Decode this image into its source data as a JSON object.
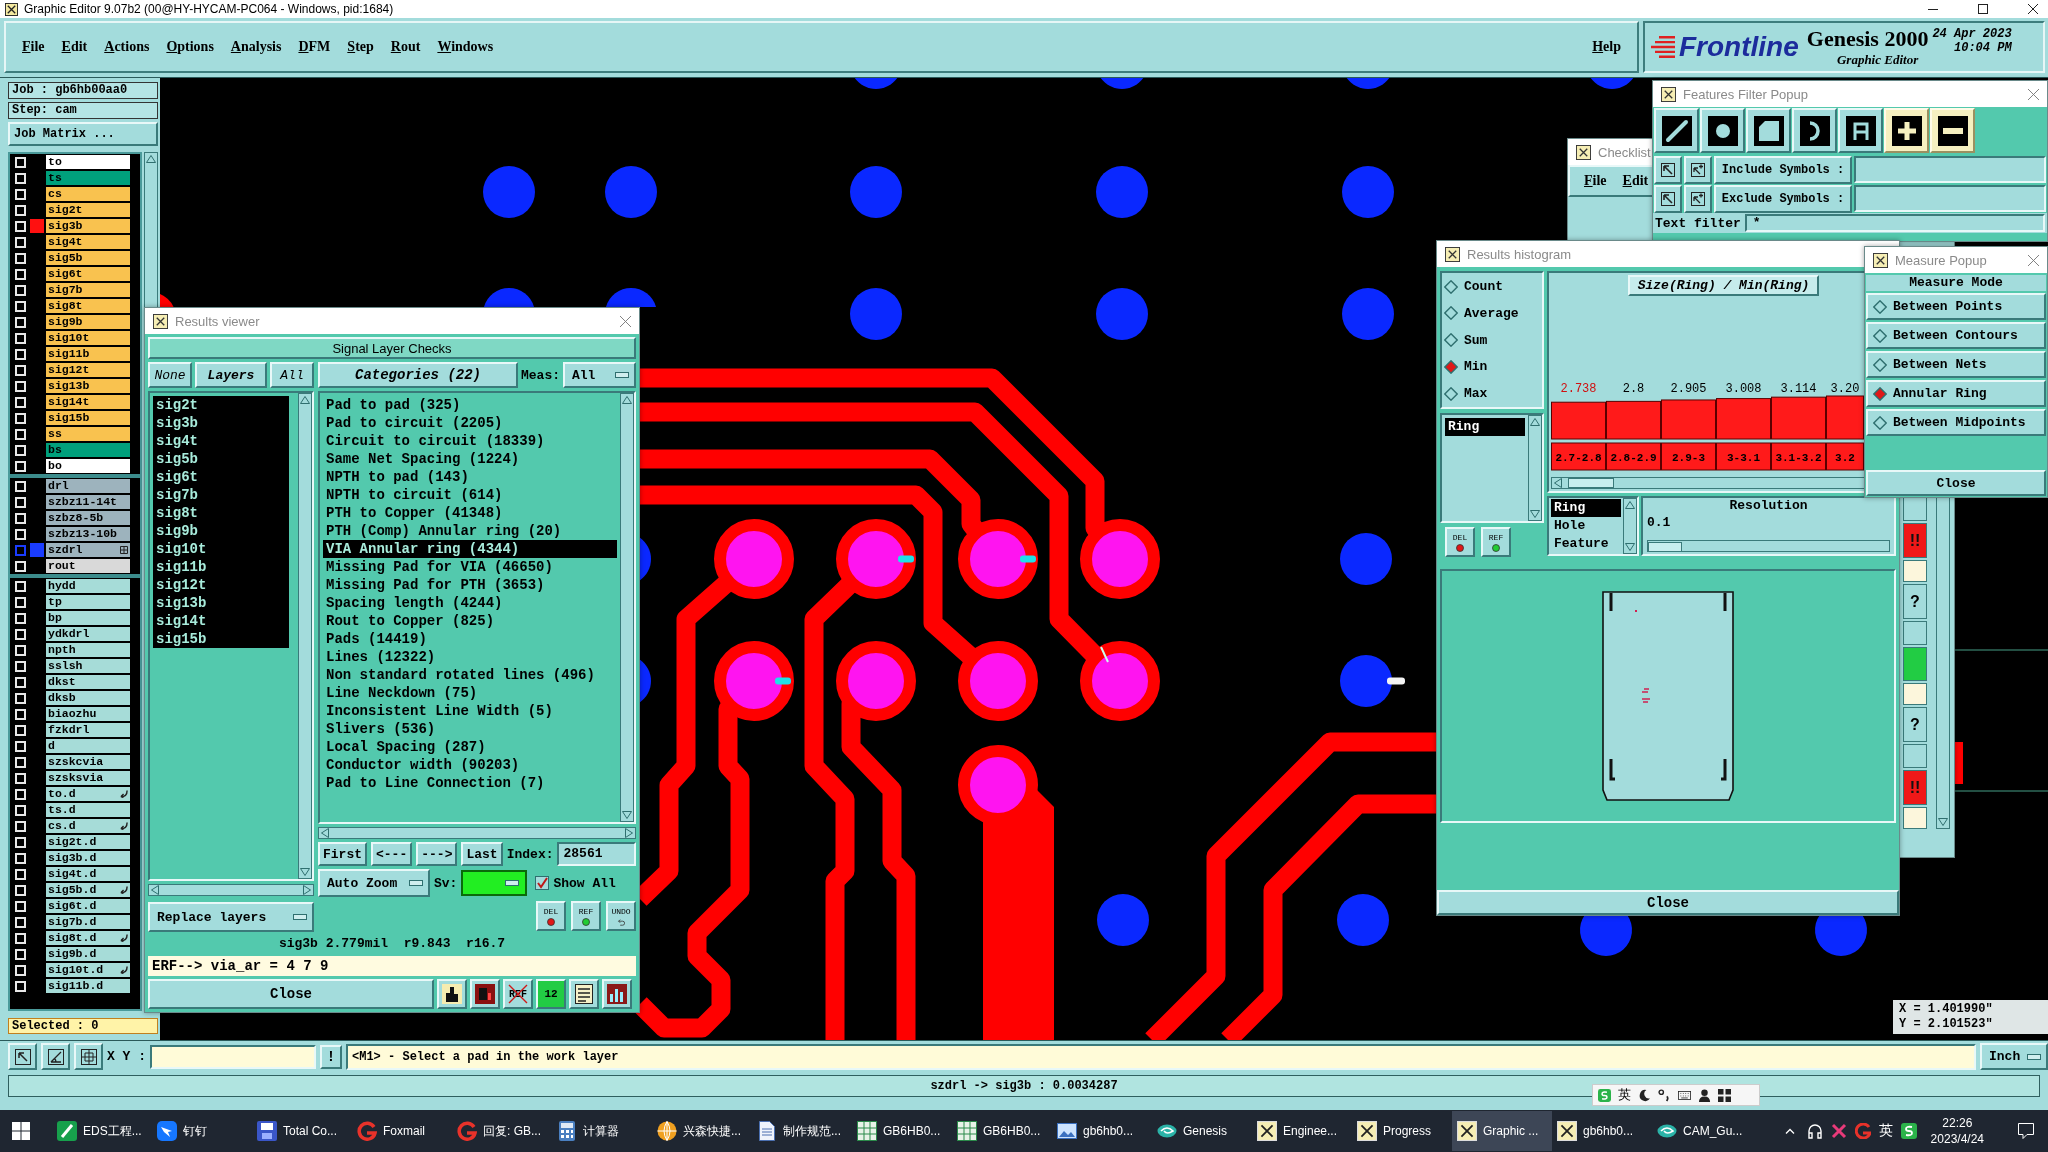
{
  "window": {
    "title": "Graphic Editor 9.07b2 (00@HY-HYCAM-PC064 - Windows, pid:1684)"
  },
  "menu": {
    "items": [
      "File",
      "Edit",
      "Actions",
      "Options",
      "Analysis",
      "DFM",
      "Step",
      "Rout",
      "Windows"
    ],
    "help": "Help"
  },
  "logo": {
    "brand": "Frontline",
    "product": "Genesis 2000",
    "subtitle": "Graphic Editor",
    "date": "24 Apr 2023",
    "time": "10:04 PM"
  },
  "job_panel": {
    "job": "Job : gb6hb00aa0",
    "step": "Step: cam",
    "matrix_button": "Job Matrix ...",
    "layer_groups": [
      {
        "layers": [
          {
            "name": "to",
            "color": "#ffffff",
            "checked": false,
            "work": false,
            "displayed": false,
            "kind": "plain"
          },
          {
            "name": "ts",
            "color": "#00a07c",
            "checked": false,
            "work": false,
            "displayed": false,
            "kind": "plain"
          },
          {
            "name": "cs",
            "color": "#f9c24f",
            "checked": false,
            "work": false,
            "displayed": false,
            "kind": "plain"
          },
          {
            "name": "sig2t",
            "color": "#f9c24f",
            "checked": false,
            "work": false,
            "displayed": false,
            "kind": "plain"
          },
          {
            "name": "sig3b",
            "color": "#f9c24f",
            "checked": false,
            "work": true,
            "displayed": false,
            "kind": "plain"
          },
          {
            "name": "sig4t",
            "color": "#f9c24f",
            "checked": false,
            "work": false,
            "displayed": false,
            "kind": "plain"
          },
          {
            "name": "sig5b",
            "color": "#f9c24f",
            "checked": false,
            "work": false,
            "displayed": false,
            "kind": "plain"
          },
          {
            "name": "sig6t",
            "color": "#f9c24f",
            "checked": false,
            "work": false,
            "displayed": false,
            "kind": "plain"
          },
          {
            "name": "sig7b",
            "color": "#f9c24f",
            "checked": false,
            "work": false,
            "displayed": false,
            "kind": "plain"
          },
          {
            "name": "sig8t",
            "color": "#f9c24f",
            "checked": false,
            "work": false,
            "displayed": false,
            "kind": "plain"
          },
          {
            "name": "sig9b",
            "color": "#f9c24f",
            "checked": false,
            "work": false,
            "displayed": false,
            "kind": "plain"
          },
          {
            "name": "sig10t",
            "color": "#f9c24f",
            "checked": false,
            "work": false,
            "displayed": false,
            "kind": "plain"
          },
          {
            "name": "sig11b",
            "color": "#f9c24f",
            "checked": false,
            "work": false,
            "displayed": false,
            "kind": "plain"
          },
          {
            "name": "sig12t",
            "color": "#f9c24f",
            "checked": false,
            "work": false,
            "displayed": false,
            "kind": "plain"
          },
          {
            "name": "sig13b",
            "color": "#f9c24f",
            "checked": false,
            "work": false,
            "displayed": false,
            "kind": "plain"
          },
          {
            "name": "sig14t",
            "color": "#f9c24f",
            "checked": false,
            "work": false,
            "displayed": false,
            "kind": "plain"
          },
          {
            "name": "sig15b",
            "color": "#f9c24f",
            "checked": false,
            "work": false,
            "displayed": false,
            "kind": "plain"
          },
          {
            "name": "ss",
            "color": "#f9c24f",
            "checked": false,
            "work": false,
            "displayed": false,
            "kind": "plain"
          },
          {
            "name": "bs",
            "color": "#00a07c",
            "checked": false,
            "work": false,
            "displayed": false,
            "kind": "plain"
          },
          {
            "name": "bo",
            "color": "#ffffff",
            "checked": false,
            "work": false,
            "displayed": false,
            "kind": "plain"
          }
        ]
      },
      {
        "layers": [
          {
            "name": "drl",
            "color": "#9db3bd",
            "checked": false,
            "work": false,
            "displayed": false,
            "kind": "plain"
          },
          {
            "name": "szbz11-14t",
            "color": "#9db3bd",
            "checked": false,
            "work": false,
            "displayed": false,
            "kind": "plain"
          },
          {
            "name": "szbz8-5b",
            "color": "#9db3bd",
            "checked": false,
            "work": false,
            "displayed": false,
            "kind": "plain"
          },
          {
            "name": "szbz13-10b",
            "color": "#9db3bd",
            "checked": false,
            "work": false,
            "displayed": false,
            "kind": "plain"
          },
          {
            "name": "szdrl",
            "color": "#9db3bd",
            "checked": false,
            "work": false,
            "displayed": true,
            "kind": "grid"
          },
          {
            "name": "rout",
            "color": "#d9d9d9",
            "checked": false,
            "work": false,
            "displayed": false,
            "kind": "plain"
          }
        ]
      },
      {
        "layers": [
          {
            "name": "hydd",
            "color": "#a6dcd8",
            "checked": false,
            "work": false,
            "displayed": false,
            "kind": "plain"
          },
          {
            "name": "tp",
            "color": "#a6dcd8",
            "checked": false,
            "work": false,
            "displayed": false,
            "kind": "plain"
          },
          {
            "name": "bp",
            "color": "#a6dcd8",
            "checked": false,
            "work": false,
            "displayed": false,
            "kind": "plain"
          },
          {
            "name": "ydkdrl",
            "color": "#a6dcd8",
            "checked": false,
            "work": false,
            "displayed": false,
            "kind": "plain"
          },
          {
            "name": "npth",
            "color": "#a6dcd8",
            "checked": false,
            "work": false,
            "displayed": false,
            "kind": "plain"
          },
          {
            "name": "sslsh",
            "color": "#a6dcd8",
            "checked": false,
            "work": false,
            "displayed": false,
            "kind": "plain"
          },
          {
            "name": "dkst",
            "color": "#a6dcd8",
            "checked": false,
            "work": false,
            "displayed": false,
            "kind": "plain"
          },
          {
            "name": "dksb",
            "color": "#a6dcd8",
            "checked": false,
            "work": false,
            "displayed": false,
            "kind": "plain"
          },
          {
            "name": "biaozhu",
            "color": "#a6dcd8",
            "checked": false,
            "work": false,
            "displayed": false,
            "kind": "plain"
          },
          {
            "name": "fzkdrl",
            "color": "#a6dcd8",
            "checked": false,
            "work": false,
            "displayed": false,
            "kind": "plain"
          },
          {
            "name": "d",
            "color": "#a6dcd8",
            "checked": false,
            "work": false,
            "displayed": false,
            "kind": "plain"
          },
          {
            "name": "szskcvia",
            "color": "#a6dcd8",
            "checked": false,
            "work": false,
            "displayed": false,
            "kind": "plain"
          },
          {
            "name": "szsksvia",
            "color": "#a6dcd8",
            "checked": false,
            "work": false,
            "displayed": false,
            "kind": "plain"
          },
          {
            "name": "to.d",
            "color": "#a6dcd8",
            "checked": false,
            "work": false,
            "displayed": false,
            "kind": "hook"
          },
          {
            "name": "ts.d",
            "color": "#a6dcd8",
            "checked": false,
            "work": false,
            "displayed": false,
            "kind": "plain"
          },
          {
            "name": "cs.d",
            "color": "#a6dcd8",
            "checked": false,
            "work": false,
            "displayed": false,
            "kind": "hook"
          },
          {
            "name": "sig2t.d",
            "color": "#a6dcd8",
            "checked": false,
            "work": false,
            "displayed": false,
            "kind": "plain"
          },
          {
            "name": "sig3b.d",
            "color": "#a6dcd8",
            "checked": false,
            "work": false,
            "displayed": false,
            "kind": "plain"
          },
          {
            "name": "sig4t.d",
            "color": "#a6dcd8",
            "checked": false,
            "work": false,
            "displayed": false,
            "kind": "plain"
          },
          {
            "name": "sig5b.d",
            "color": "#a6dcd8",
            "checked": false,
            "work": false,
            "displayed": false,
            "kind": "hook"
          },
          {
            "name": "sig6t.d",
            "color": "#a6dcd8",
            "checked": false,
            "work": false,
            "displayed": false,
            "kind": "plain"
          },
          {
            "name": "sig7b.d",
            "color": "#a6dcd8",
            "checked": false,
            "work": false,
            "displayed": false,
            "kind": "plain"
          },
          {
            "name": "sig8t.d",
            "color": "#a6dcd8",
            "checked": false,
            "work": false,
            "displayed": false,
            "kind": "hook"
          },
          {
            "name": "sig9b.d",
            "color": "#a6dcd8",
            "checked": false,
            "work": false,
            "displayed": false,
            "kind": "plain"
          },
          {
            "name": "sig10t.d",
            "color": "#a6dcd8",
            "checked": false,
            "work": false,
            "displayed": false,
            "kind": "hook"
          },
          {
            "name": "sig11b.d",
            "color": "#a6dcd8",
            "checked": false,
            "work": false,
            "displayed": false,
            "kind": "plain"
          }
        ]
      }
    ],
    "selected_count": "Selected : 0"
  },
  "canvas": {
    "readout_x": "X = 1.401990\"",
    "readout_y": "Y = 2.101523\""
  },
  "results_viewer": {
    "title": "Results viewer",
    "header": "Signal Layer Checks",
    "layer_buttons": [
      {
        "label": "None",
        "kind": "toggle"
      },
      {
        "label": "Layers",
        "kind": "title"
      },
      {
        "label": "All",
        "kind": "toggle"
      }
    ],
    "layers": [
      {
        "name": "sig2t",
        "selected": true
      },
      {
        "name": "sig3b",
        "selected": true
      },
      {
        "name": "sig4t",
        "selected": true
      },
      {
        "name": "sig5b",
        "selected": true
      },
      {
        "name": "sig6t",
        "selected": true
      },
      {
        "name": "sig7b",
        "selected": true
      },
      {
        "name": "sig8t",
        "selected": true
      },
      {
        "name": "sig9b",
        "selected": true
      },
      {
        "name": "sig10t",
        "selected": true
      },
      {
        "name": "sig11b",
        "selected": true
      },
      {
        "name": "sig12t",
        "selected": true
      },
      {
        "name": "sig13b",
        "selected": true
      },
      {
        "name": "sig14t",
        "selected": true
      },
      {
        "name": "sig15b",
        "selected": true
      }
    ],
    "replace": "Replace layers",
    "categories_button": "Categories (22)",
    "meas_label": "Meas:",
    "meas_value": "All",
    "categories": [
      {
        "label": "Pad to pad (325)",
        "selected": false
      },
      {
        "label": "Pad to circuit (2205)",
        "selected": false
      },
      {
        "label": "Circuit to circuit (18339)",
        "selected": false
      },
      {
        "label": "Same Net Spacing (1224)",
        "selected": false
      },
      {
        "label": "NPTH to pad (143)",
        "selected": false
      },
      {
        "label": "NPTH to circuit (614)",
        "selected": false
      },
      {
        "label": "PTH to Copper (41348)",
        "selected": false
      },
      {
        "label": "PTH (Comp) Annular ring (20)",
        "selected": false
      },
      {
        "label": "VIA Annular ring (4344)",
        "selected": true
      },
      {
        "label": "Missing Pad for VIA (46650)",
        "selected": false
      },
      {
        "label": "Missing Pad for PTH (3653)",
        "selected": false
      },
      {
        "label": "Spacing length (4244)",
        "selected": false
      },
      {
        "label": "Rout to Copper (825)",
        "selected": false
      },
      {
        "label": "Pads (14419)",
        "selected": false
      },
      {
        "label": "Lines (12322)",
        "selected": false
      },
      {
        "label": "Non standard rotated lines (496)",
        "selected": false
      },
      {
        "label": "Line Neckdown (75)",
        "selected": false
      },
      {
        "label": "Inconsistent Line Width (5)",
        "selected": false
      },
      {
        "label": "Slivers (536)",
        "selected": false
      },
      {
        "label": "Local Spacing (287)",
        "selected": false
      },
      {
        "label": "Conductor width (90203)",
        "selected": false
      },
      {
        "label": "Pad to Line Connection (7)",
        "selected": false
      }
    ],
    "nav": [
      "First",
      "<---",
      "--->",
      "Last"
    ],
    "index_label": "Index:",
    "index_value": "28561",
    "zoom_mode": "Auto Zoom",
    "sv": {
      "label": "Sv:",
      "color": "#22ee22"
    },
    "show_all": {
      "label": "Show All",
      "checked": true
    },
    "tools": [
      {
        "kind": "del",
        "label": "DEL"
      },
      {
        "kind": "ref",
        "label": "REF"
      },
      {
        "kind": "undo",
        "label": "UNDO"
      }
    ],
    "info": "sig3b 2.779mil  r9.843  r16.7",
    "erf": "ERF--> via_ar = 4 7 9",
    "close": "Close",
    "bottom_tools": [
      {
        "kind": "figure"
      },
      {
        "kind": "stop"
      },
      {
        "kind": "ref-off",
        "label": "REF"
      },
      {
        "kind": "count",
        "label": "12"
      },
      {
        "kind": "report"
      },
      {
        "kind": "chart"
      }
    ]
  },
  "checklist": {
    "title": "Checklist",
    "menu": [
      "File",
      "Edit"
    ],
    "status": [
      {
        "kind": "blank"
      },
      {
        "kind": "fail",
        "mark": "!!"
      },
      {
        "kind": "pending"
      },
      {
        "kind": "query",
        "mark": "?"
      },
      {
        "kind": "blank"
      },
      {
        "kind": "pass"
      },
      {
        "kind": "pending"
      },
      {
        "kind": "query",
        "mark": "?"
      },
      {
        "kind": "blank"
      },
      {
        "kind": "fail",
        "mark": "!!"
      },
      {
        "kind": "pending"
      }
    ]
  },
  "features_filter": {
    "title": "Features Filter Popup",
    "types": [
      {
        "kind": "line"
      },
      {
        "kind": "pad"
      },
      {
        "kind": "surface"
      },
      {
        "kind": "arc"
      },
      {
        "kind": "text"
      }
    ],
    "modes": [
      {
        "kind": "plus"
      },
      {
        "kind": "minus"
      }
    ],
    "include_label": "Include Symbols :",
    "exclude_label": "Exclude Symbols :",
    "text_filter_label": "Text filter",
    "text_filter_value": "*"
  },
  "results_histogram": {
    "title": "Results histogram",
    "functions": [
      {
        "label": "Count",
        "selected": false
      },
      {
        "label": "Average",
        "selected": false
      },
      {
        "label": "Sum",
        "selected": false
      },
      {
        "label": "Min",
        "selected": true
      },
      {
        "label": "Max",
        "selected": false
      }
    ],
    "measures": [
      {
        "label": "Ring",
        "selected": true
      }
    ],
    "tools": [
      {
        "kind": "del",
        "label": "DEL"
      },
      {
        "kind": "ref",
        "label": "REF"
      }
    ],
    "chart_data": {
      "type": "bar",
      "title": "Size(Ring) / Min(Ring)",
      "categories": [
        "2.7-2.8",
        "2.8-2.9",
        "2.9-3",
        "3-3.1",
        "3.1-3.2",
        "3.2"
      ],
      "values": [
        2.738,
        2.8,
        2.905,
        3.008,
        3.114,
        3.2
      ],
      "value_labels": [
        "2.738",
        "2.8",
        "2.905",
        "3.008",
        "3.114",
        "3.20"
      ]
    },
    "fields": [
      {
        "label": "Ring",
        "selected": true
      },
      {
        "label": "Hole",
        "selected": false
      },
      {
        "label": "Feature",
        "selected": false
      }
    ],
    "resolution": {
      "label": "Resolution",
      "value": "0.1",
      "level": 0
    },
    "close": "Close"
  },
  "measure_popup": {
    "title": "Measure Popup",
    "header": "Measure Mode",
    "modes": [
      {
        "label": "Between Points",
        "selected": false
      },
      {
        "label": "Between Contours",
        "selected": false
      },
      {
        "label": "Between Nets",
        "selected": false
      },
      {
        "label": "Annular Ring",
        "selected": true
      },
      {
        "label": "Between Midpoints",
        "selected": false
      }
    ],
    "close": "Close"
  },
  "toolbar": {
    "tools": [
      {
        "kind": "pointer"
      },
      {
        "kind": "angle"
      },
      {
        "kind": "grid"
      }
    ],
    "xy_label": "X Y :",
    "bang": "!",
    "prompt": "<M1> - Select a pad in the work layer",
    "units": "Inch"
  },
  "status_bar": {
    "text": "szdrl -> sig3b : 0.0034287"
  },
  "ime": {
    "lang": "英"
  },
  "taskbar": {
    "items": [
      {
        "label": "EDS工程...",
        "kind": "tile",
        "selected": false
      },
      {
        "label": "钉钉",
        "kind": "wing",
        "selected": false
      },
      {
        "label": "Total Co...",
        "kind": "floppy",
        "selected": false
      },
      {
        "label": "Foxmail",
        "kind": "ring",
        "selected": false
      },
      {
        "label": "回复: GB...",
        "kind": "ring",
        "selected": false
      },
      {
        "label": "计算器",
        "kind": "calc",
        "selected": false
      },
      {
        "label": "兴森快捷...",
        "kind": "globe",
        "selected": false
      },
      {
        "label": "制作规范...",
        "kind": "doc",
        "selected": false
      },
      {
        "label": "GB6HB0...",
        "kind": "sheet",
        "selected": false
      },
      {
        "label": "GB6HB0...",
        "kind": "sheet",
        "selected": false
      },
      {
        "label": "gb6hb0...",
        "kind": "image",
        "selected": false
      },
      {
        "label": "Genesis",
        "kind": "swirl",
        "selected": false
      },
      {
        "label": "Enginee...",
        "kind": "xwin",
        "selected": false
      },
      {
        "label": "Progress",
        "kind": "xwin",
        "selected": false
      },
      {
        "label": "Graphic ...",
        "kind": "xwin",
        "selected": true
      },
      {
        "label": "gb6hb0...",
        "kind": "xwin",
        "selected": false
      },
      {
        "label": "CAM_Gu...",
        "kind": "swirl",
        "selected": false
      }
    ],
    "tray": {
      "lang": "英",
      "time": "22:26",
      "date": "2023/4/24"
    }
  }
}
